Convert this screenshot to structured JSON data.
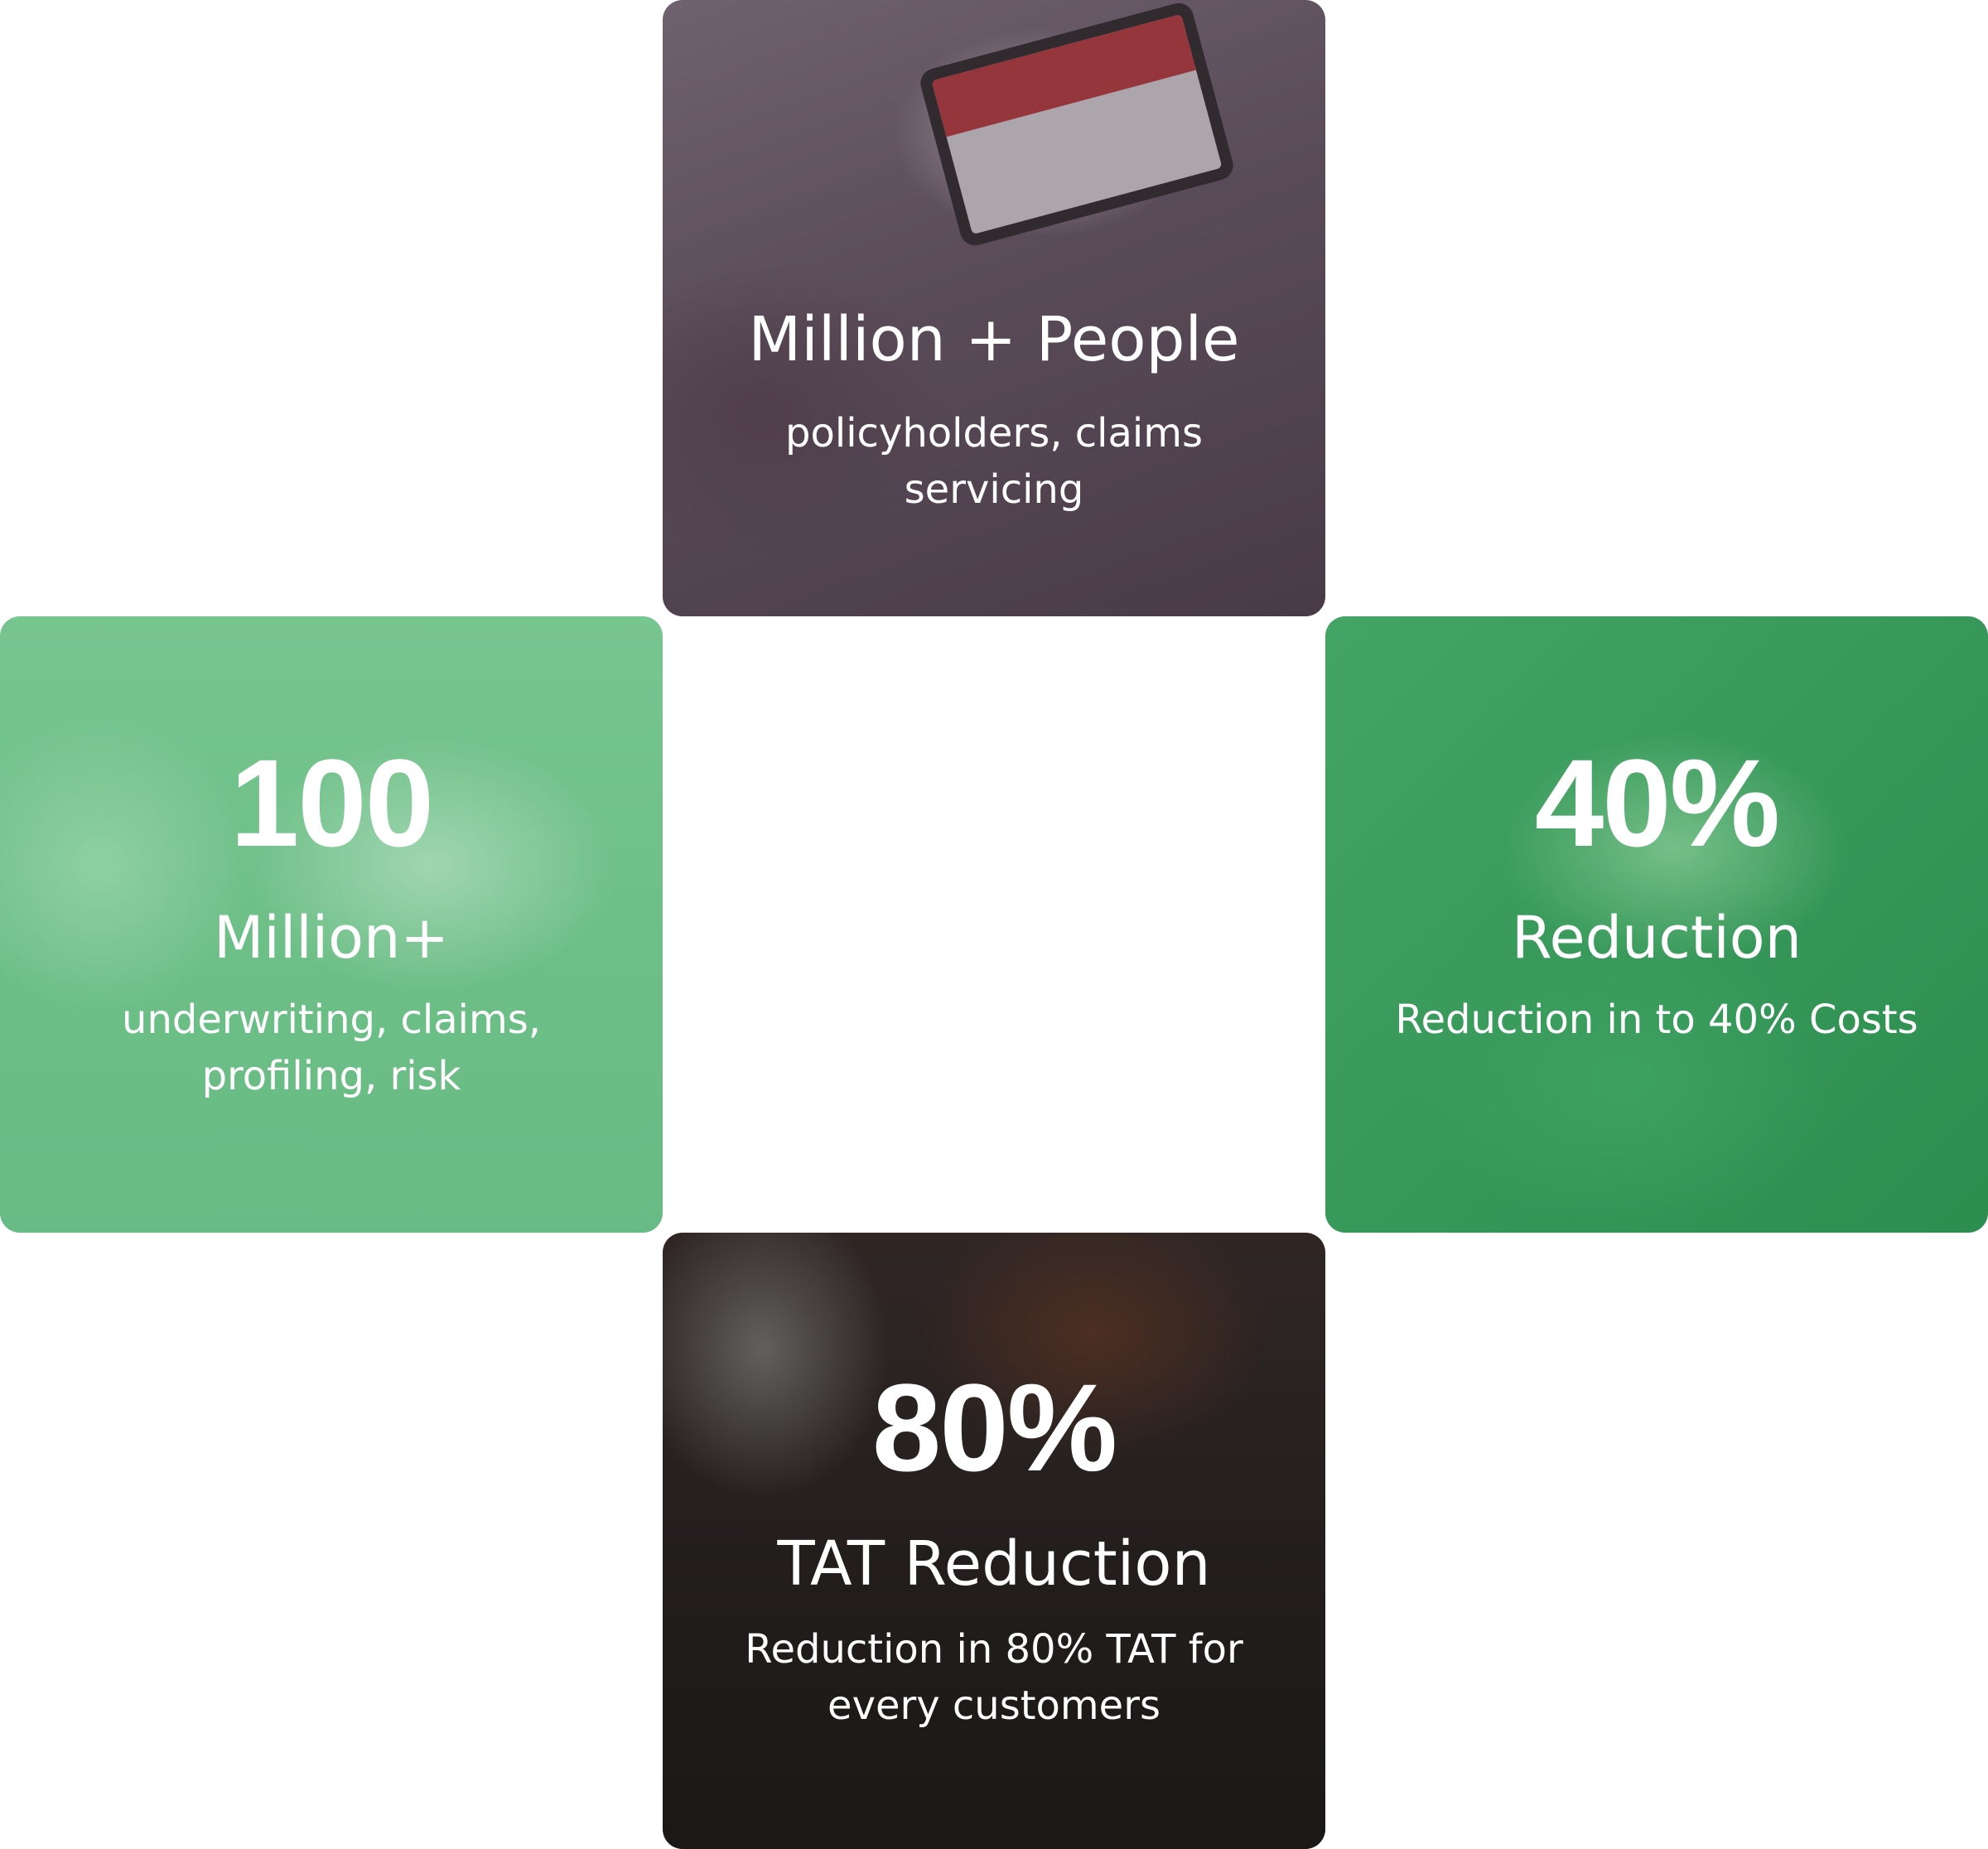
{
  "cards": {
    "top": {
      "heading": "Million + People",
      "subtitle": "policyholders, claims servicing"
    },
    "left": {
      "number": "100",
      "heading": "Million+",
      "subtitle": "underwriting, claims, profiling, risk"
    },
    "right": {
      "number": "40%",
      "heading": "Reduction",
      "subtitle": "Reduction in to 40% Costs"
    },
    "bottom": {
      "number": "80%",
      "heading": "TAT Reduction",
      "subtitle": "Reduction in 80% TAT for every customers"
    }
  },
  "colors": {
    "text": "#ffffff",
    "green_light": "#7ac793",
    "green_dark": "#3f9a5f",
    "grey_purple": "#6b5d69",
    "dark_brown": "#2b2524"
  }
}
